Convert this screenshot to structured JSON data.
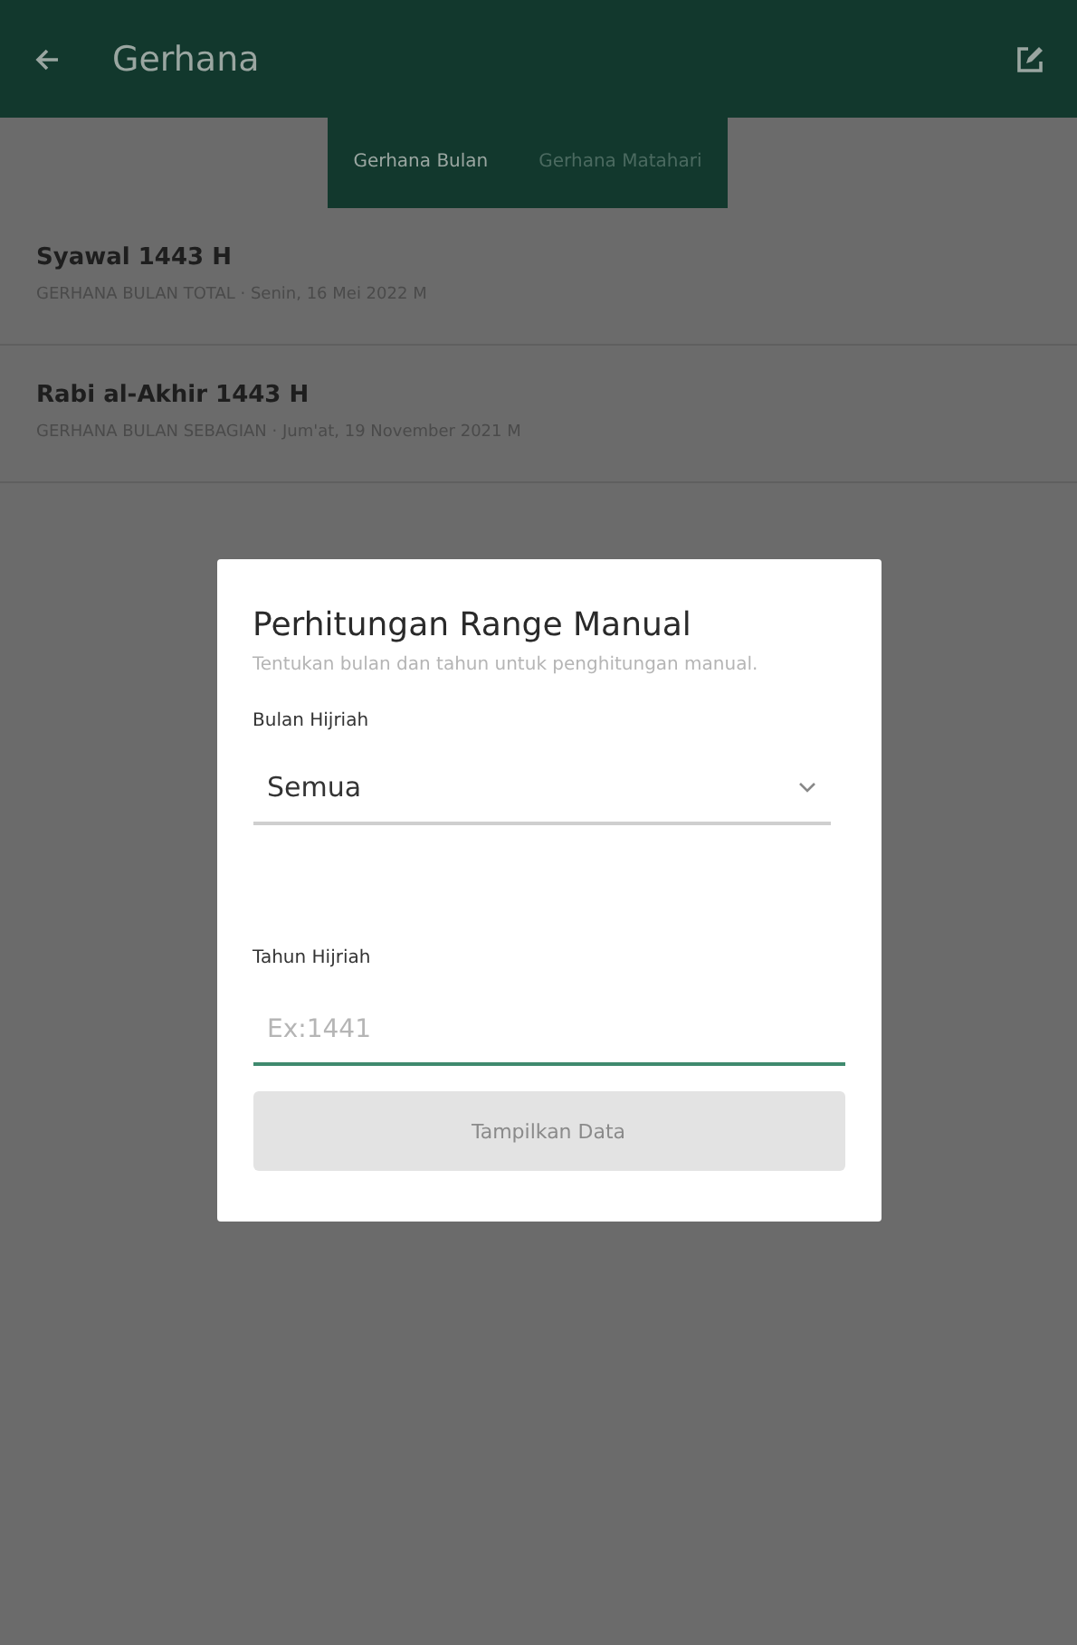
{
  "app_bar": {
    "title": "Gerhana"
  },
  "tabs": [
    {
      "label": "Gerhana Bulan",
      "selected": true
    },
    {
      "label": "Gerhana Matahari",
      "selected": false
    }
  ],
  "list": [
    {
      "title": "Syawal 1443 H",
      "subtitle": "GERHANA BULAN TOTAL · Senin, 16 Mei 2022 M"
    },
    {
      "title": "Rabi al-Akhir 1443 H",
      "subtitle": "GERHANA BULAN SEBAGIAN · Jum'at, 19 November 2021 M"
    }
  ],
  "dialog": {
    "title": "Perhitungan Range Manual",
    "description": "Tentukan bulan dan tahun untuk penghitungan manual.",
    "month_label": "Bulan Hijriah",
    "month_value": "Semua",
    "year_label": "Tahun Hijriah",
    "year_placeholder": "Ex:1441",
    "year_focused": true,
    "button": {
      "label": "Tampilkan Data",
      "disabled": true
    }
  }
}
